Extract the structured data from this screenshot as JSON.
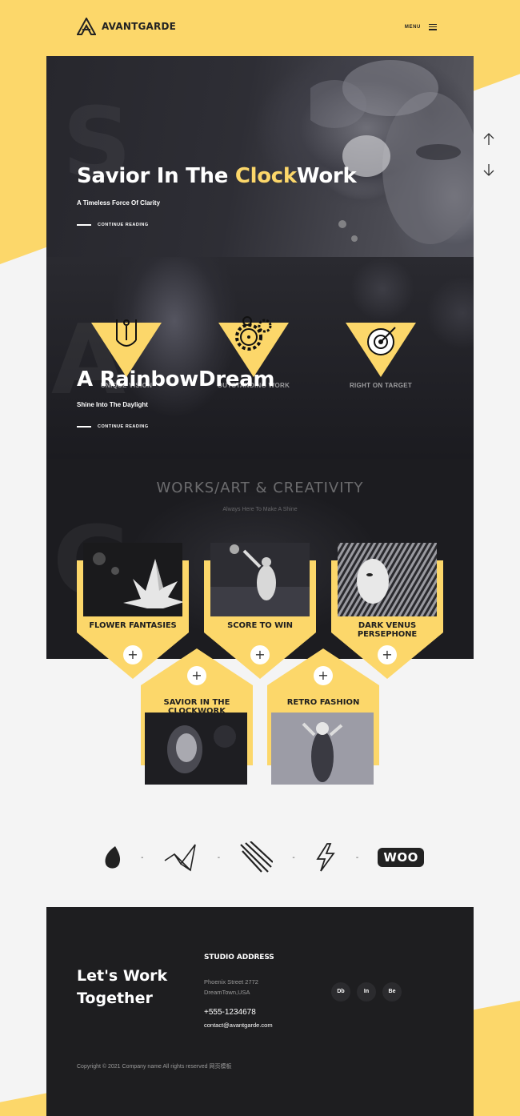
{
  "brand": {
    "name": "AVANTGARDE"
  },
  "nav": {
    "menu_label": "MENU"
  },
  "colors": {
    "accent": "#fcd76a",
    "dark": "#1e1e20",
    "background": "#f4f4f4"
  },
  "hero": {
    "slide1": {
      "title_prefix": "Savior In The ",
      "title_highlight": "Clock",
      "title_suffix": "Work",
      "subtitle": "A Timeless Force Of Clarity",
      "cta": "CONTINUE READING",
      "ghost_letter": "S"
    },
    "slide2": {
      "title": "A RainbowDream",
      "subtitle": "Shine Into The Daylight",
      "cta": "CONTINUE READING",
      "ghost_letter": "A"
    }
  },
  "services": [
    {
      "label": "UNIQUE VISION",
      "icon": "pen-tool-icon"
    },
    {
      "label": "OUTSTANDING WORK",
      "icon": "gears-icon"
    },
    {
      "label": "RIGHT ON TARGET",
      "icon": "target-icon"
    }
  ],
  "works": {
    "title": "WORKS/ART & CREATIVITY",
    "subtitle": "Always Here To Make A Shine"
  },
  "portfolio": [
    {
      "title": "FLOWER FANTASIES"
    },
    {
      "title": "SCORE TO WIN"
    },
    {
      "title": "DARK VENUS PERSEPHONE"
    },
    {
      "title": "SAVIOR IN THE CLOCKWORK"
    },
    {
      "title": "RETRO FASHION"
    }
  ],
  "plus_symbol": "+",
  "brands": [
    {
      "icon": "envato-leaf-icon"
    },
    {
      "icon": "origami-bird-icon"
    },
    {
      "icon": "claw-marks-icon"
    },
    {
      "icon": "lightning-icon"
    },
    {
      "icon": "woo-logo-icon",
      "text": "WOO"
    }
  ],
  "brand_separator": "-",
  "footer": {
    "cta": "Let's Work Together",
    "address_title": "STUDIO ADDRESS",
    "address_line1": "Phoenix Street 2772",
    "address_line2": "DreamTown,USA",
    "phone": "+555-1234678",
    "email": "contact@avantgarde.com",
    "socials": [
      "Db",
      "In",
      "Be"
    ],
    "copyright": "Copyright © 2021 Company name All rights reserved 网页模板"
  }
}
